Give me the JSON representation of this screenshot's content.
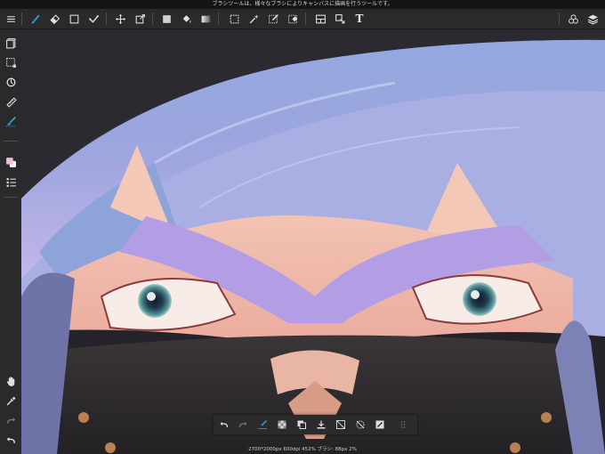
{
  "hint_text": "ブラシツールは、様々なブラシによりキャンバスに描画を行うツールです。",
  "status_text": "2700*2000px 600dpi 452% ブラシ: 88px 2%",
  "text_tool_label": "T",
  "colors": {
    "accent": "#2aa7d8",
    "toolbar_bg": "#2a2a2c",
    "icon": "#e0e0e0",
    "foreground": "#f3b7dc",
    "background": "#ffffff"
  },
  "icons": {
    "menu": "hamburger-icon",
    "brush": "brush-icon",
    "eraser": "eraser-icon",
    "shape": "square-icon",
    "select_transform": "check-transform-icon",
    "move": "move-icon",
    "transform": "transform-icon",
    "fill": "fill-square-icon",
    "bucket": "bucket-icon",
    "gradient": "gradient-icon",
    "select_rect": "selection-rect-icon",
    "magic_wand": "magic-wand-icon",
    "select_pen": "selection-pen-icon",
    "select_eraser": "selection-eraser-icon",
    "frame": "frame-divide-icon",
    "operation": "operation-icon",
    "text": "text-icon",
    "materials": "materials-icon",
    "layers": "layers-icon"
  }
}
